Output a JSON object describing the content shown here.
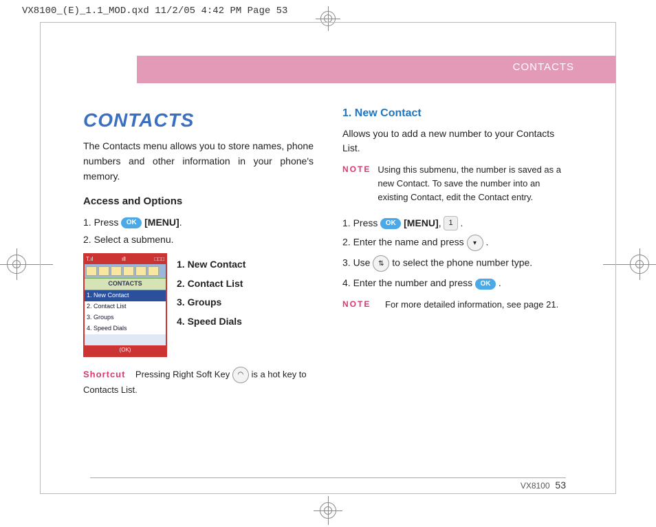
{
  "top_header": "VX8100_(E)_1.1_MOD.qxd  11/2/05  4:42 PM  Page 53",
  "pink_header": "CONTACTS",
  "left": {
    "title": "CONTACTS",
    "intro": "The Contacts menu allows you to store names, phone numbers and other information in your phone's memory.",
    "access_heading": "Access and Options",
    "step1_prefix": "1.  Press ",
    "step1_menu": "[MENU]",
    "step1_suffix": ".",
    "step2": "2.  Select a submenu.",
    "phone": {
      "top_left": "T.ıl",
      "top_center": "ıll",
      "top_right": "□□□",
      "banner": "CONTACTS",
      "rows": [
        "1.  New Contact",
        "2.  Contact List",
        "3.  Groups",
        "4.  Speed Dials"
      ],
      "ok": "OK"
    },
    "submenu": [
      "1. New Contact",
      "2. Contact List",
      "3. Groups",
      "4. Speed Dials"
    ],
    "shortcut_label": "Shortcut",
    "shortcut_text_a": "Pressing Right Soft Key ",
    "shortcut_text_b": " is a hot key to Contacts List."
  },
  "right": {
    "heading": "1. New Contact",
    "intro": "Allows you to add a new number to your Contacts List.",
    "note_label": "NOTE",
    "note1": "Using this submenu, the number is saved as a new Contact. To save the number into an existing Contact, edit the Contact entry.",
    "step1a": "1.  Press ",
    "step1_menu": "[MENU]",
    "step1b": ", ",
    "one_key": "1",
    "step1c": " .",
    "step2a": "2.  Enter the name and press ",
    "step2b": " .",
    "step3a": "3.  Use ",
    "step3b": " to select the phone number type.",
    "step4a": "4.  Enter the number and press ",
    "step4b": " .",
    "note2": "For more detailed information, see page 21."
  },
  "ok_text": "OK",
  "footer": {
    "model": "VX8100",
    "page": "53"
  }
}
